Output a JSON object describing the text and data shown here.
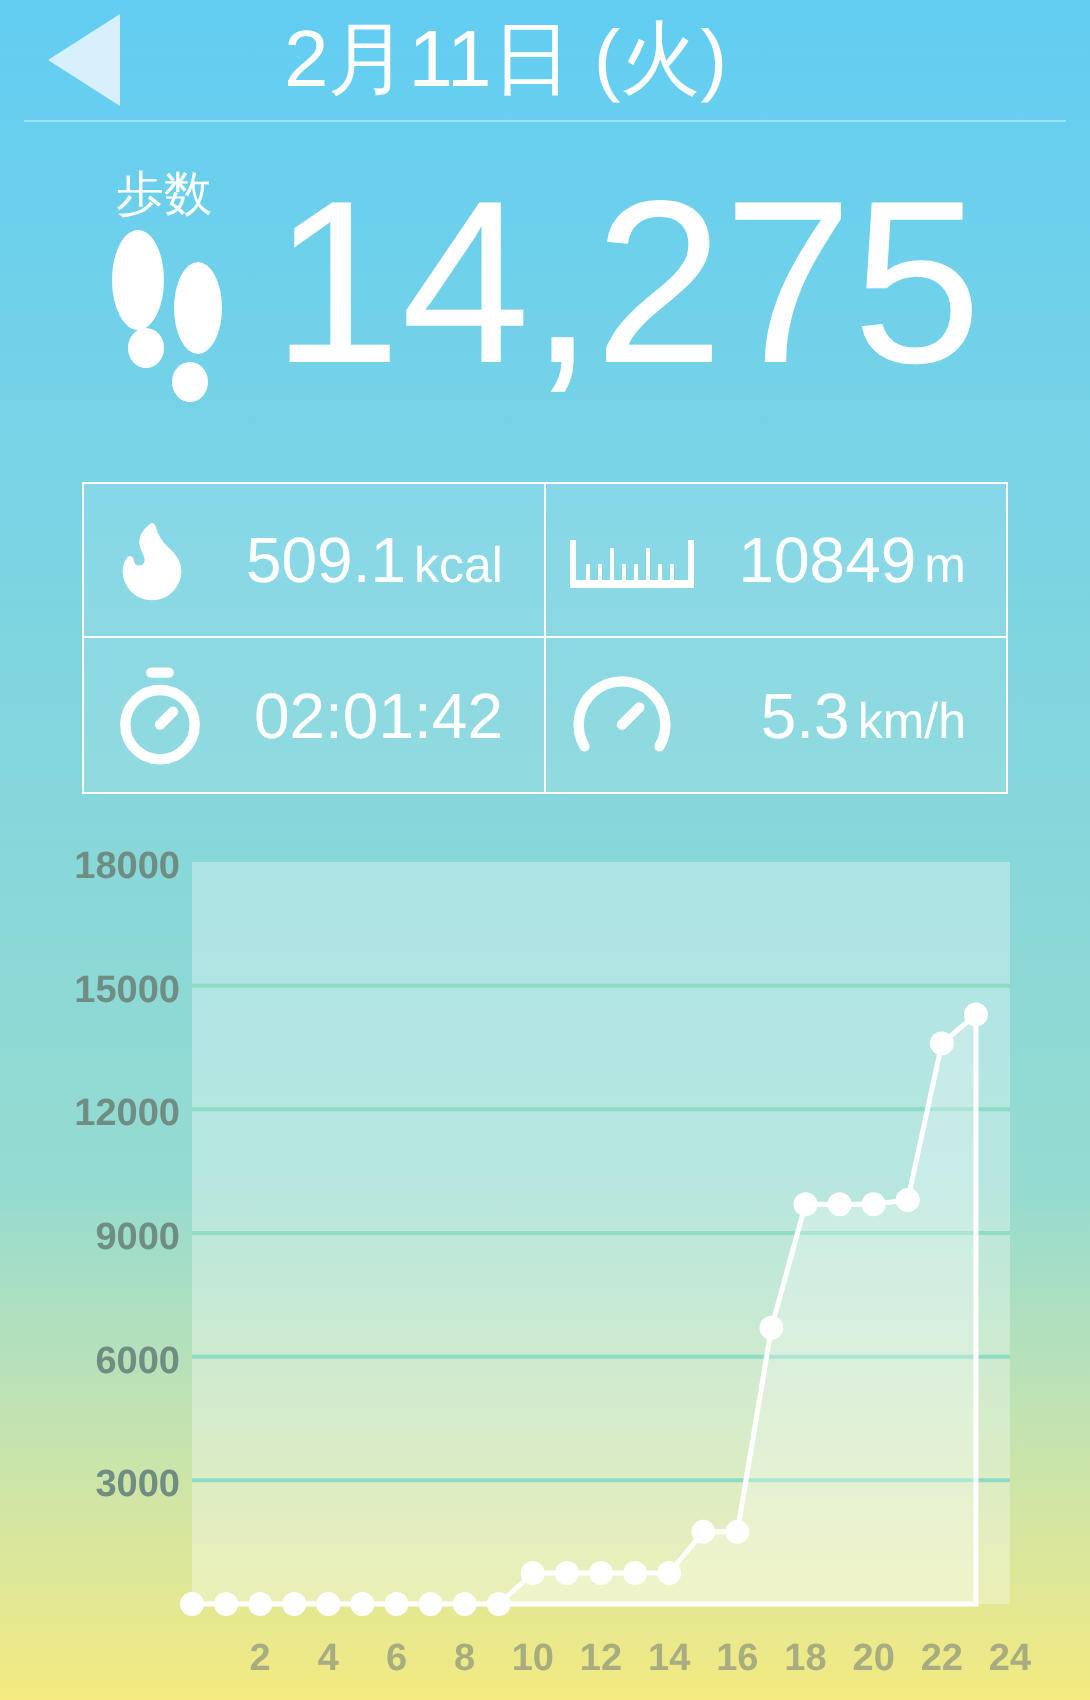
{
  "header": {
    "title": "2月11日 (火)"
  },
  "steps": {
    "label": "歩数",
    "value": "14,275"
  },
  "stats": [
    {
      "kind": "calories",
      "value": "509.1",
      "unit": "kcal"
    },
    {
      "kind": "distance",
      "value": "10849",
      "unit": "m"
    },
    {
      "kind": "time",
      "value": "02:01:42"
    },
    {
      "kind": "speed",
      "value": "5.3",
      "unit": "km/h"
    }
  ],
  "chart": {
    "chart_data": {
      "type": "area",
      "x": [
        0,
        1,
        2,
        3,
        4,
        5,
        6,
        7,
        8,
        9,
        10,
        11,
        12,
        13,
        14,
        15,
        16,
        17,
        18,
        19,
        20,
        21,
        22,
        23
      ],
      "series": [
        {
          "color": "#ffffff",
          "values": [
            0,
            0,
            0,
            0,
            0,
            0,
            0,
            0,
            0,
            0,
            750,
            750,
            750,
            750,
            750,
            1750,
            1750,
            6700,
            9700,
            9700,
            9700,
            9800,
            13600,
            14300
          ]
        }
      ],
      "xlim": [
        0,
        24
      ],
      "ylim": [
        0,
        18000
      ],
      "grid": true,
      "xticks": [
        2,
        4,
        6,
        8,
        10,
        12,
        14,
        16,
        18,
        20,
        22,
        24
      ],
      "yticks": [
        3000,
        6000,
        9000,
        12000,
        15000,
        18000
      ]
    }
  }
}
